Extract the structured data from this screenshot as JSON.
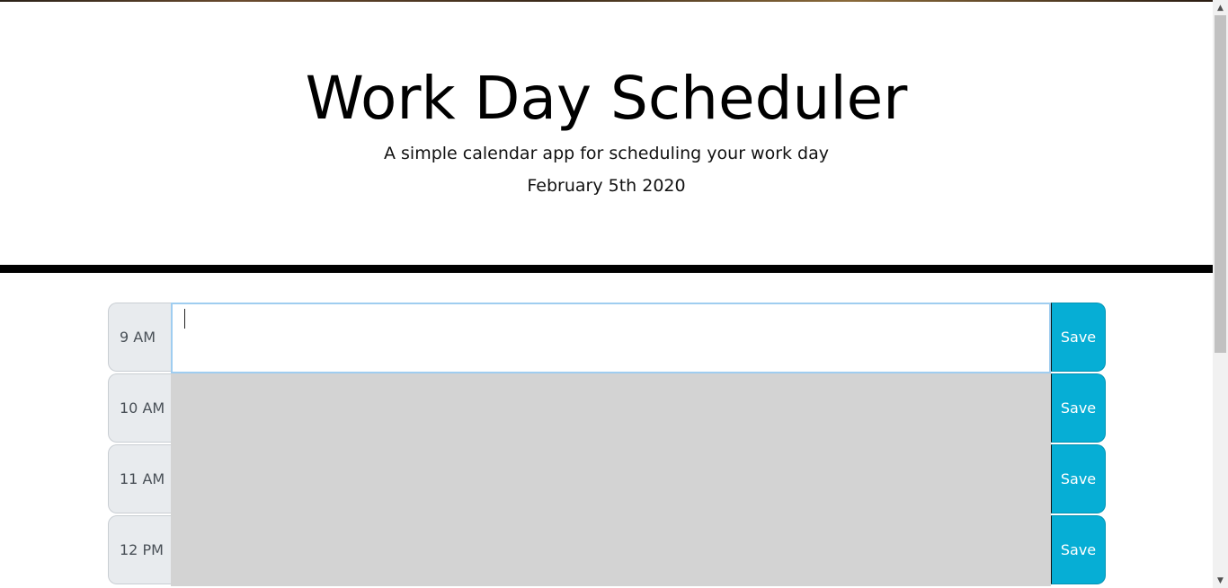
{
  "header": {
    "title": "Work Day Scheduler",
    "lead": "A simple calendar app for scheduling your work day",
    "current_day": "February 5th 2020"
  },
  "timeblocks": [
    {
      "hour": "9 AM",
      "status": "present",
      "text": "",
      "save_label": "Save"
    },
    {
      "hour": "10 AM",
      "status": "past",
      "text": "",
      "save_label": "Save"
    },
    {
      "hour": "11 AM",
      "status": "past",
      "text": "",
      "save_label": "Save"
    },
    {
      "hour": "12 PM",
      "status": "past",
      "text": "",
      "save_label": "Save"
    }
  ],
  "colors": {
    "save_button": "#06aed5",
    "past_block": "#d3d3d3",
    "present_block": "#ffffff",
    "hour_label_bg": "#e8ebee",
    "divider": "#000000"
  },
  "scrollbar": {
    "up_icon": "arrow-up-icon",
    "down_icon": "arrow-down-icon"
  }
}
